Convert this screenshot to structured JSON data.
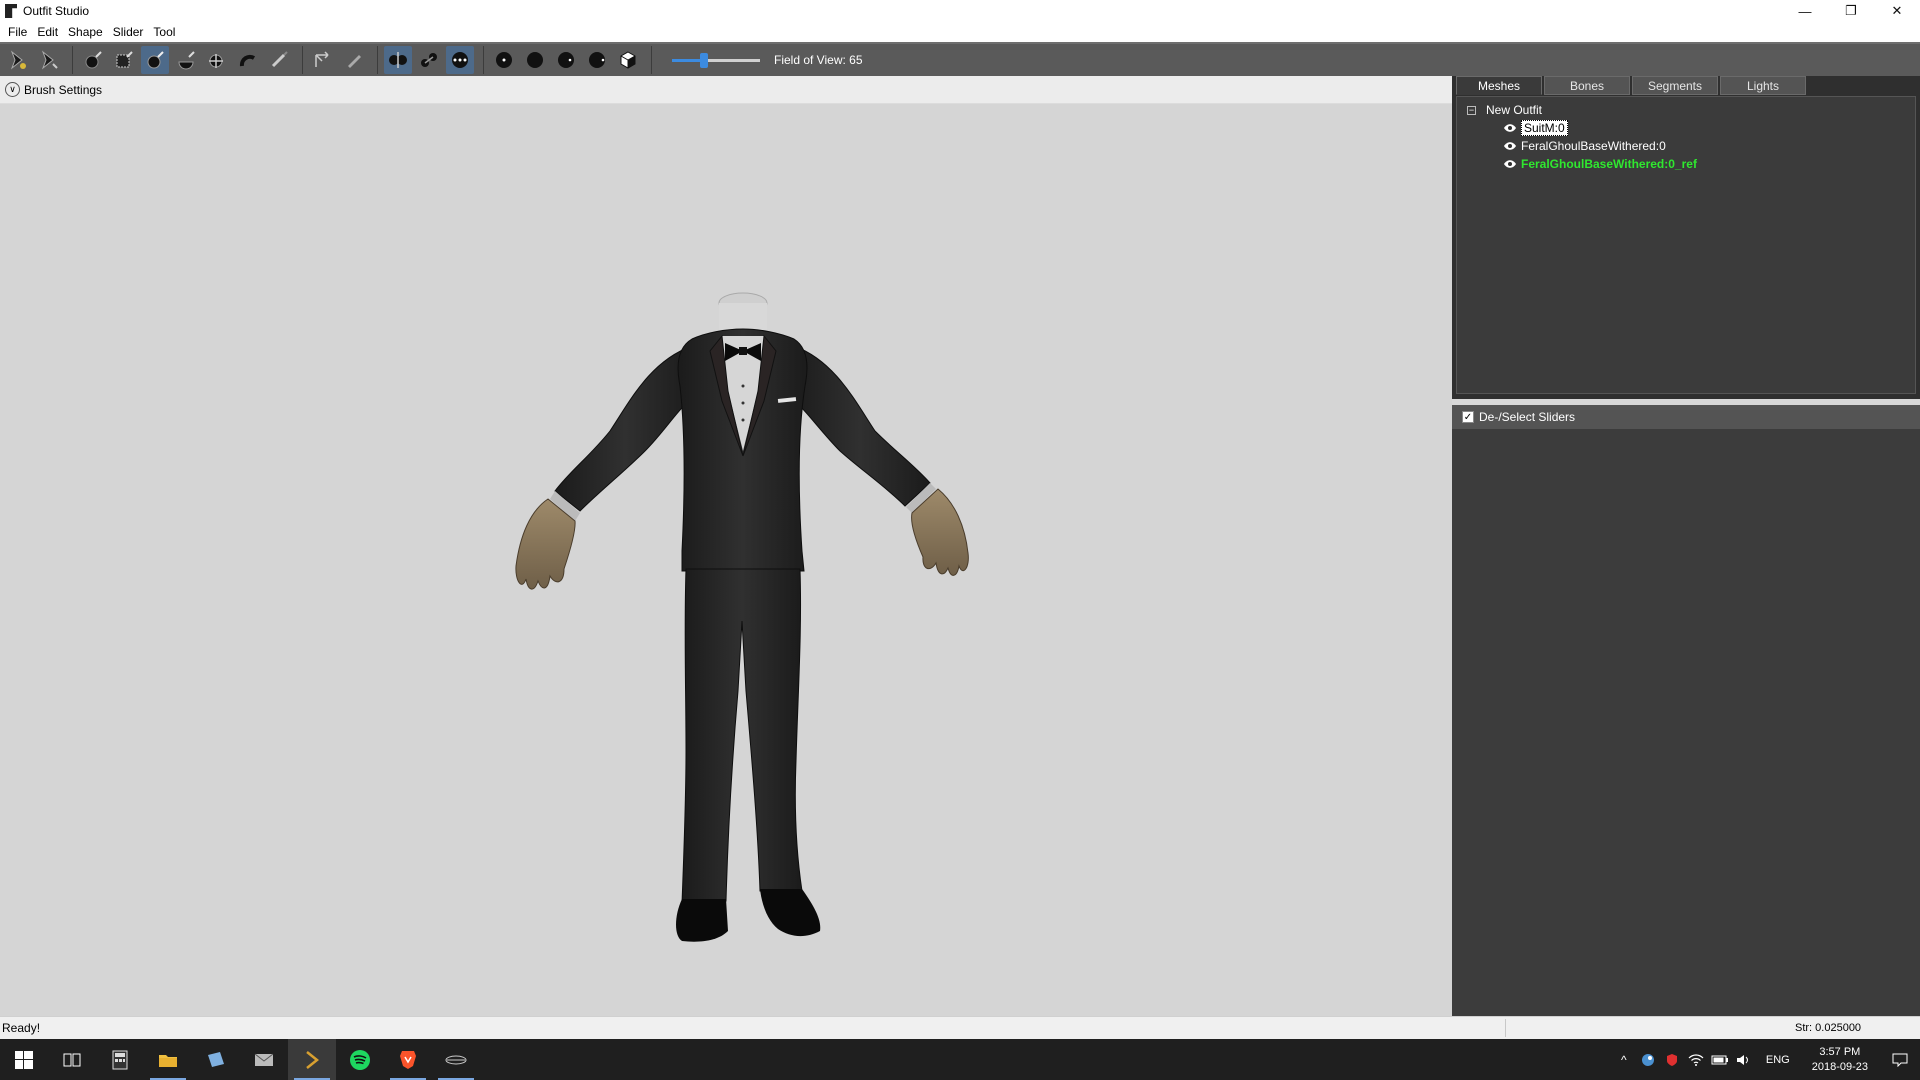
{
  "window": {
    "title": "Outfit Studio",
    "controls": {
      "minimize": "—",
      "restore": "❐",
      "close": "✕"
    }
  },
  "menu": [
    "File",
    "Edit",
    "Shape",
    "Slider",
    "Tool"
  ],
  "toolbar": {
    "fov_label": "Field of View: 65",
    "fov_value": 65,
    "slider_fraction": 0.36,
    "icons": [
      "select-icon",
      "transform-icon",
      "mask-brush-icon",
      "inflate-brush-icon",
      "deflate-brush-icon",
      "move-brush-icon",
      "smooth-brush-icon",
      "undiff-brush-icon",
      "weight-brush-icon",
      "color-brush-icon",
      "x-mirror-icon",
      "connected-only-icon",
      "global-brush-icon",
      "wireframe-icon",
      "lighting-icon",
      "textures-icon",
      "vertex-color-icon",
      "cube-icon"
    ]
  },
  "viewport": {
    "brush_settings_label": "Brush Settings",
    "background": "#d5d5d5"
  },
  "panel": {
    "tabs": [
      "Meshes",
      "Bones",
      "Segments",
      "Lights"
    ],
    "active_tab": "Meshes",
    "tree_root": "New Outfit",
    "meshes": [
      {
        "name": "SuitM:0",
        "state": "selected"
      },
      {
        "name": "FeralGhoulBaseWithered:0",
        "state": "normal"
      },
      {
        "name": "FeralGhoulBaseWithered:0_ref",
        "state": "reference"
      }
    ],
    "slider_header": "De-/Select Sliders",
    "reference_color": "#2fe82f"
  },
  "status": {
    "left": "Ready!",
    "right": "Str: 0.025000"
  },
  "taskbar": {
    "apps": [
      "start-icon",
      "task-view-icon",
      "calculator-icon",
      "file-explorer-icon",
      "notes-icon",
      "mail-icon",
      "outfit-studio-icon",
      "spotify-icon",
      "brave-icon",
      "network-tool-icon"
    ],
    "lang": "ENG",
    "time": "3:57 PM",
    "date": "2018-09-23"
  }
}
